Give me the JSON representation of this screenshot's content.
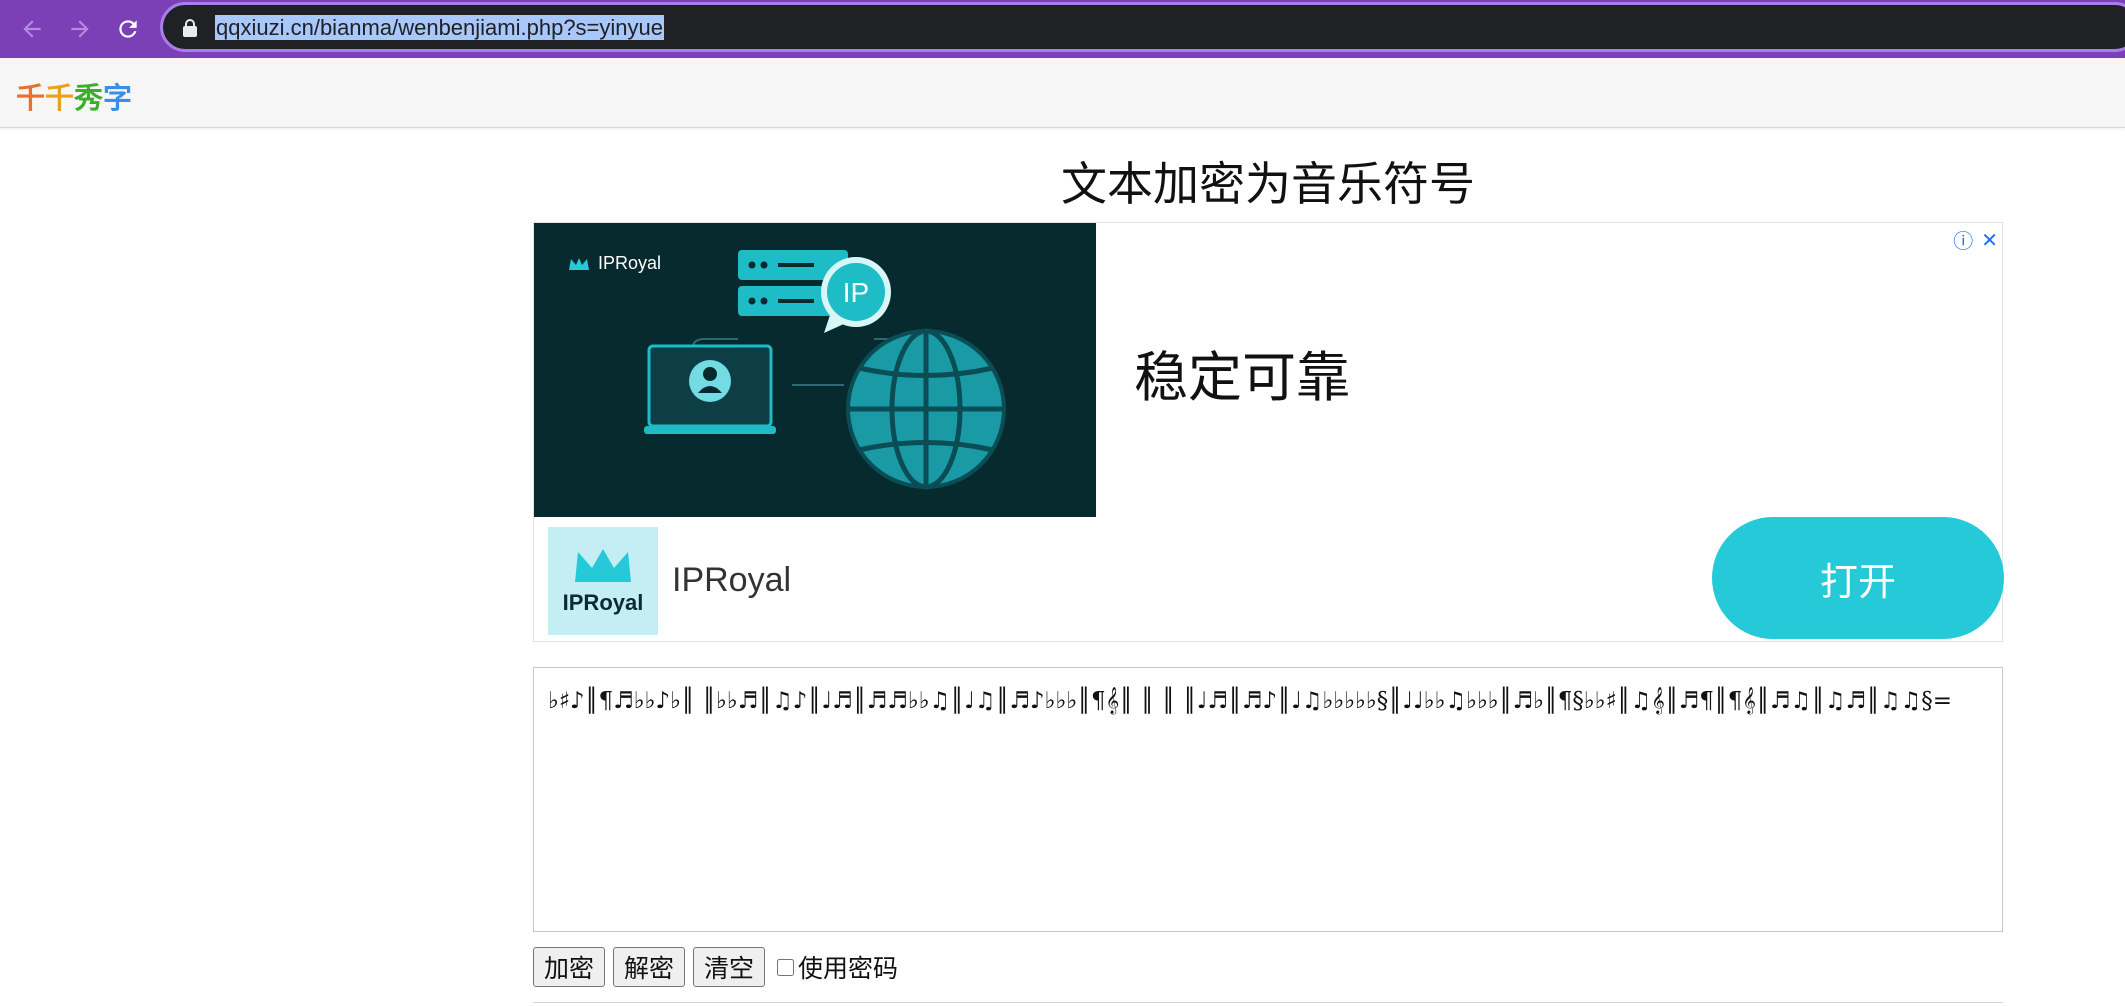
{
  "browser": {
    "url": "qqxiuzi.cn/bianma/wenbenjiami.php?s=yinyue"
  },
  "site": {
    "logo_chars": [
      "千",
      "千",
      "秀",
      "字"
    ]
  },
  "page": {
    "title": "文本加密为音乐符号"
  },
  "ad": {
    "brand_small": "IPRoyal",
    "badge": "IP",
    "headline": "稳定可靠",
    "logo_text": "IPRoyal",
    "advertiser": "IPRoyal",
    "open_button": "打开",
    "info_icon": "ⓘ",
    "close_icon": "✕",
    "colors": {
      "image_bg": "#072a2f",
      "accent": "#26c9d8"
    }
  },
  "editor": {
    "content": "♭♯♪║¶♬♭♭♪♭║ ║♭♭♬║♫♪║♩♬║♬♬♭♭♫║♩♫║♬♪♭♭♭║¶𝄞║ ║ ║ ║♩♬║♬♪║♩♫♭♭♭♭♭§║♩♩♭♭♫♭♭♭║♬♭║¶§♭♭♯║♫𝄞║♬¶║¶𝄞║♬♫║♫♬║♫♫§="
  },
  "controls": {
    "encrypt": "加密",
    "decrypt": "解密",
    "clear": "清空",
    "use_password": "使用密码",
    "use_password_checked": false
  }
}
